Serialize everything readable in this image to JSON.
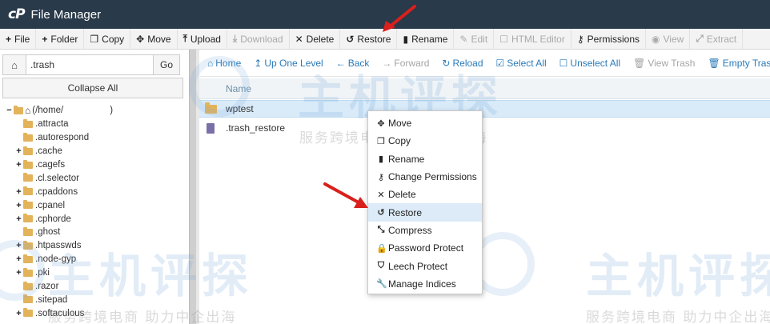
{
  "app": {
    "logo": "cP",
    "title": "File Manager"
  },
  "toolbar": {
    "items": [
      {
        "icon": "plus-icon",
        "label": "File",
        "enabled": true
      },
      {
        "icon": "plus-icon",
        "label": "Folder",
        "enabled": true
      },
      {
        "icon": "copy-icon",
        "label": "Copy",
        "enabled": true
      },
      {
        "icon": "move-icon",
        "label": "Move",
        "enabled": true
      },
      {
        "icon": "upload-icon",
        "label": "Upload",
        "enabled": true
      },
      {
        "icon": "download-icon",
        "label": "Download",
        "enabled": false
      },
      {
        "icon": "close-icon",
        "label": "Delete",
        "enabled": true
      },
      {
        "icon": "restore-icon",
        "label": "Restore",
        "enabled": true
      },
      {
        "icon": "file-icon",
        "label": "Rename",
        "enabled": true
      },
      {
        "icon": "pencil-icon",
        "label": "Edit",
        "enabled": false
      },
      {
        "icon": "html-editor-icon",
        "label": "HTML Editor",
        "enabled": false
      },
      {
        "icon": "key-icon",
        "label": "Permissions",
        "enabled": true
      },
      {
        "icon": "eye-icon",
        "label": "View",
        "enabled": false
      },
      {
        "icon": "extract-icon",
        "label": "Extract",
        "enabled": false
      }
    ]
  },
  "left_panel": {
    "path_value": ".trash",
    "go_label": "Go",
    "collapse_label": "Collapse All",
    "tree": [
      {
        "label": "(/home/",
        "suffix": ")",
        "expander": "−",
        "root": true
      },
      {
        "label": ".attracta",
        "expander": ""
      },
      {
        "label": ".autorespond",
        "expander": ""
      },
      {
        "label": ".cache",
        "expander": "+"
      },
      {
        "label": ".cagefs",
        "expander": "+"
      },
      {
        "label": ".cl.selector",
        "expander": ""
      },
      {
        "label": ".cpaddons",
        "expander": "+"
      },
      {
        "label": ".cpanel",
        "expander": "+"
      },
      {
        "label": ".cphorde",
        "expander": "+"
      },
      {
        "label": ".ghost",
        "expander": ""
      },
      {
        "label": ".htpasswds",
        "expander": "+"
      },
      {
        "label": ".node-gyp",
        "expander": "+"
      },
      {
        "label": ".pki",
        "expander": "+"
      },
      {
        "label": ".razor",
        "expander": ""
      },
      {
        "label": ".sitepad",
        "expander": ""
      },
      {
        "label": ".softaculous",
        "expander": "+"
      }
    ]
  },
  "navbar": {
    "items": [
      {
        "icon": "home-icon",
        "label": "Home",
        "enabled": true
      },
      {
        "icon": "up-arrow-icon",
        "label": "Up One Level",
        "enabled": true
      },
      {
        "icon": "back-arrow-icon",
        "label": "Back",
        "enabled": true
      },
      {
        "icon": "forward-arrow-icon",
        "label": "Forward",
        "enabled": false
      },
      {
        "icon": "reload-icon",
        "label": "Reload",
        "enabled": true
      },
      {
        "icon": "check-square-icon",
        "label": "Select All",
        "enabled": true
      },
      {
        "icon": "square-icon",
        "label": "Unselect All",
        "enabled": true
      },
      {
        "icon": "trash-icon",
        "label": "View Trash",
        "enabled": false
      },
      {
        "icon": "trash-icon",
        "label": "Empty Trash",
        "enabled": true
      }
    ]
  },
  "file_list": {
    "column_name": "Name",
    "rows": [
      {
        "name": "wptest",
        "type": "folder",
        "selected": true
      },
      {
        "name": ".trash_restore",
        "type": "file",
        "selected": false
      }
    ]
  },
  "context_menu": {
    "items": [
      {
        "icon": "move-icon",
        "label": "Move"
      },
      {
        "icon": "copy-icon",
        "label": "Copy"
      },
      {
        "icon": "file-icon",
        "label": "Rename"
      },
      {
        "icon": "key-icon",
        "label": "Change Permissions"
      },
      {
        "icon": "close-icon",
        "label": "Delete"
      },
      {
        "icon": "restore-icon",
        "label": "Restore",
        "hover": true
      },
      {
        "icon": "compress-icon",
        "label": "Compress"
      },
      {
        "icon": "lock-icon",
        "label": "Password Protect"
      },
      {
        "icon": "shield-icon",
        "label": "Leech Protect"
      },
      {
        "icon": "wrench-icon",
        "label": "Manage Indices"
      }
    ]
  },
  "watermark": {
    "big": "主机评探",
    "small": "服务跨境电商 助力中企出海"
  },
  "colors": {
    "titlebar": "#293a4a",
    "link": "#2a7ab8",
    "selected_row": "#d9ebf9",
    "arrow": "#d9201c"
  }
}
